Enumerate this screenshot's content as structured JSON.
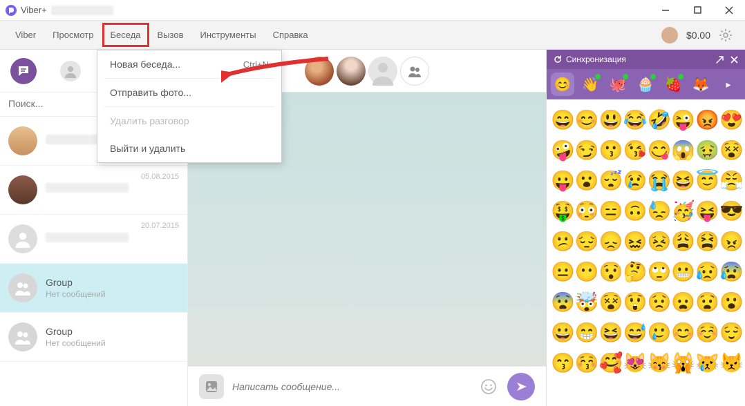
{
  "titlebar": {
    "app_name": "Viber",
    "phone_blurred": true
  },
  "menubar": {
    "items": [
      "Viber",
      "Просмотр",
      "Беседа",
      "Вызов",
      "Инструменты",
      "Справка"
    ],
    "highlighted_index": 2,
    "balance": "$0.00"
  },
  "dropdown": {
    "items": [
      {
        "label": "Новая беседа...",
        "shortcut": "Ctrl+N",
        "enabled": true
      },
      {
        "label": "Отправить фото...",
        "shortcut": "",
        "enabled": true
      },
      {
        "label": "Удалить разговор",
        "shortcut": "",
        "enabled": false
      },
      {
        "label": "Выйти и удалить",
        "shortcut": "",
        "enabled": true
      }
    ]
  },
  "sidebar": {
    "search_placeholder": "Поиск...",
    "conversations": [
      {
        "name_blurred": true,
        "date": "",
        "sub": ""
      },
      {
        "name_blurred": true,
        "date": "05.08.2015",
        "sub": ""
      },
      {
        "name_blurred": true,
        "date": "20.07.2015",
        "sub": ""
      },
      {
        "name": "Group",
        "sub": "Нет сообщений",
        "group": true,
        "selected": true
      },
      {
        "name": "Group",
        "sub": "Нет сообщений",
        "group": true
      }
    ]
  },
  "chat": {
    "input_placeholder": "Написать сообщение..."
  },
  "sticker_panel": {
    "header": "Синхронизация",
    "emoji_rows": [
      [
        "😄",
        "😊",
        "😃",
        "😂",
        "🤣",
        "😜",
        "😡",
        "😍"
      ],
      [
        "🤪",
        "😏",
        "😗",
        "😘",
        "😋",
        "😱",
        "🤢",
        "😵"
      ],
      [
        "😛",
        "😮",
        "😴",
        "😢",
        "😭",
        "😆",
        "😇",
        "😤"
      ],
      [
        "🤑",
        "😳",
        "😑",
        "🙃",
        "😓",
        "🥳",
        "😝",
        "😎"
      ],
      [
        "😕",
        "😔",
        "😞",
        "😖",
        "😣",
        "😩",
        "😫",
        "😠"
      ],
      [
        "😐",
        "😶",
        "😯",
        "🤔",
        "🙄",
        "😬",
        "😥",
        "😰"
      ],
      [
        "😨",
        "🤯",
        "😵",
        "😲",
        "😟",
        "😦",
        "😧",
        "😮"
      ],
      [
        "😀",
        "😁",
        "😆",
        "😅",
        "🥲",
        "😊",
        "☺️",
        "😌"
      ],
      [
        "😙",
        "😚",
        "🥰",
        "😻",
        "😽",
        "🙀",
        "😿",
        "😾"
      ]
    ]
  },
  "colors": {
    "viber_purple": "#7b519d",
    "panel_purple": "#8a63b3",
    "accent_red": "#e03030",
    "send_purple": "#9b7fd4",
    "selected_teal": "#cdeef3"
  }
}
